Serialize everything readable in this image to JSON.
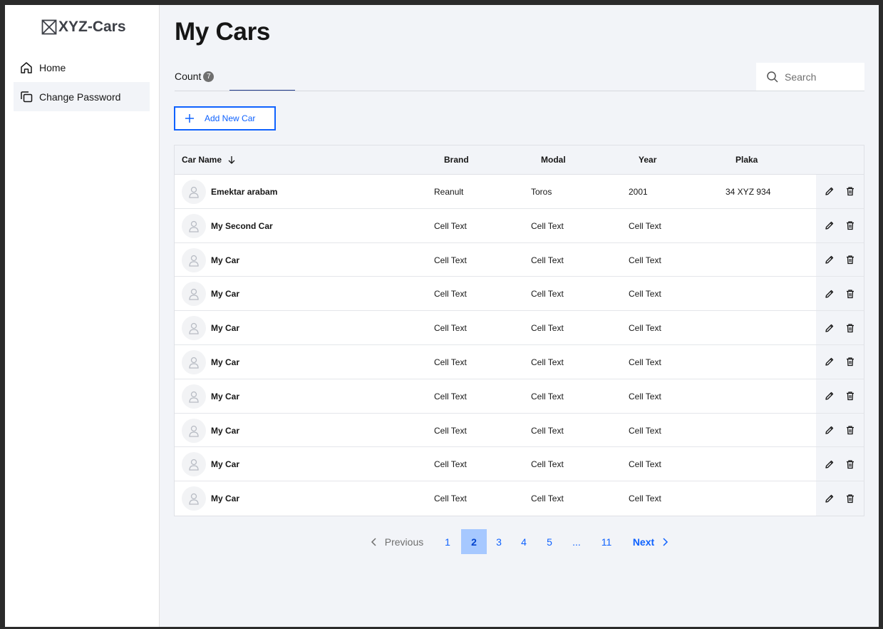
{
  "app": {
    "logo_text": "XYZ-Cars"
  },
  "sidebar": {
    "items": [
      {
        "label": "Home"
      },
      {
        "label": "Change Password"
      }
    ]
  },
  "page": {
    "title": "My Cars"
  },
  "tabs": {
    "count_label": "Count",
    "count_value": "7"
  },
  "search": {
    "placeholder": "Search"
  },
  "toolbar": {
    "add_label": "Add New Car"
  },
  "table": {
    "headers": {
      "name": "Car Name",
      "brand": "Brand",
      "model": "Modal",
      "year": "Year",
      "plate": "Plaka"
    },
    "rows": [
      {
        "name": "Emektar arabam",
        "brand": "Reanult",
        "model": "Toros",
        "year": "2001",
        "plate": "34 XYZ 934"
      },
      {
        "name": "My Second Car",
        "brand": "Cell Text",
        "model": "Cell Text",
        "year": "Cell Text",
        "plate": ""
      },
      {
        "name": "My Car",
        "brand": "Cell Text",
        "model": "Cell Text",
        "year": "Cell Text",
        "plate": ""
      },
      {
        "name": "My Car",
        "brand": "Cell Text",
        "model": "Cell Text",
        "year": "Cell Text",
        "plate": ""
      },
      {
        "name": "My Car",
        "brand": "Cell Text",
        "model": "Cell Text",
        "year": "Cell Text",
        "plate": ""
      },
      {
        "name": "My Car",
        "brand": "Cell Text",
        "model": "Cell Text",
        "year": "Cell Text",
        "plate": ""
      },
      {
        "name": "My Car",
        "brand": "Cell Text",
        "model": "Cell Text",
        "year": "Cell Text",
        "plate": ""
      },
      {
        "name": "My Car",
        "brand": "Cell Text",
        "model": "Cell Text",
        "year": "Cell Text",
        "plate": ""
      },
      {
        "name": "My Car",
        "brand": "Cell Text",
        "model": "Cell Text",
        "year": "Cell Text",
        "plate": ""
      },
      {
        "name": "My Car",
        "brand": "Cell Text",
        "model": "Cell Text",
        "year": "Cell Text",
        "plate": ""
      }
    ]
  },
  "pagination": {
    "previous_label": "Previous",
    "next_label": "Next",
    "pages": [
      "1",
      "2",
      "3",
      "4",
      "5",
      "...",
      "11"
    ],
    "current": "2"
  },
  "colors": {
    "accent": "#0f62fe",
    "current_page_bg": "#a6c8ff",
    "tab_indicator": "#1f3a8a",
    "background": "#f2f4f8"
  }
}
